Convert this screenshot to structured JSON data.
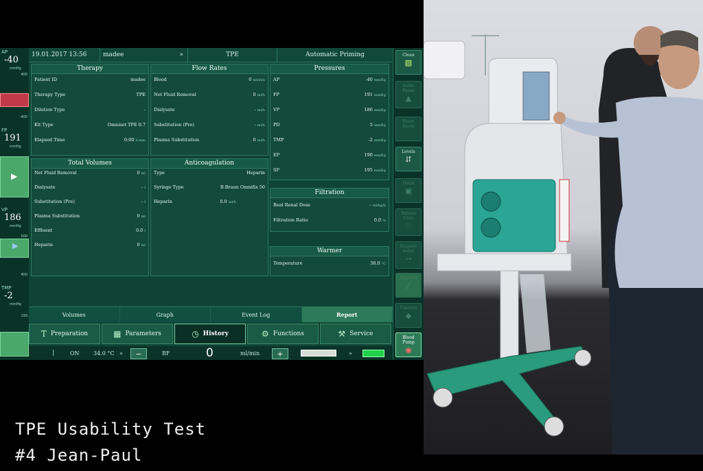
{
  "caption": {
    "line1": "TPE Usability Test",
    "line2": "#4 Jean-Paul"
  },
  "topbar": {
    "date": "19.01.2017 13:56",
    "user": "madee",
    "mode": "TPE",
    "phase": "Automatic Priming",
    "chev1": "»",
    "chev2": "»"
  },
  "left_gauges": [
    {
      "label": "AP",
      "value": "-40",
      "unit": "mmHg",
      "tick_top": "400",
      "tick_bot": "-400"
    },
    {
      "label": "FP",
      "value": "191",
      "unit": "mmHg",
      "tick_top": "",
      "tick_bot": ""
    },
    {
      "label": "VP",
      "value": "186",
      "unit": "mmHg",
      "tick_top": "500",
      "tick_bot": "400"
    },
    {
      "label": "TMP",
      "value": "-2",
      "unit": "mmHg",
      "tick_top": "150",
      "tick_bot": ""
    }
  ],
  "right_buttons": [
    {
      "label": "Clean",
      "icon": "clean-icon",
      "glyph": "▧",
      "state": "normal"
    },
    {
      "label": "Audio Pause",
      "icon": "bell-icon",
      "glyph": "▲",
      "state": "dim"
    },
    {
      "label": "Reset Alarm",
      "icon": "reset-icon",
      "glyph": "",
      "state": "dim"
    },
    {
      "label": "Levels",
      "icon": "levels-icon",
      "glyph": "⇵",
      "state": "normal"
    },
    {
      "label": "Drain",
      "icon": "drain-icon",
      "glyph": "▣",
      "state": "dim"
    },
    {
      "label": "Patient Care",
      "icon": "patient-care-icon",
      "glyph": "♡",
      "state": "dim"
    },
    {
      "label": "Heparin bolus",
      "icon": "syringe-icon",
      "glyph": "→",
      "state": "dim"
    },
    {
      "label": "Heparin",
      "icon": "heparin-icon",
      "glyph": "╱",
      "state": "dim"
    },
    {
      "label": "Unitairs",
      "icon": "unitairs-icon",
      "glyph": "◆",
      "state": "dim"
    },
    {
      "label": "Blood Pump",
      "icon": "blood-pump-icon",
      "glyph": "◉",
      "state": "active"
    }
  ],
  "panels": {
    "therapy": {
      "title": "Therapy",
      "rows": [
        {
          "k": "Patient ID",
          "v": "madee",
          "u": ""
        },
        {
          "k": "Therapy Type",
          "v": "TPE",
          "u": ""
        },
        {
          "k": "Dilution Type",
          "v": "-",
          "u": ""
        },
        {
          "k": "Kit Type",
          "v": "Omniset TPE 0.7",
          "u": ""
        },
        {
          "k": "Elapsed Time",
          "v": "0:00",
          "u": "h:mm"
        }
      ]
    },
    "flow": {
      "title": "Flow Rates",
      "rows": [
        {
          "k": "Blood",
          "v": "0",
          "u": "ml/min"
        },
        {
          "k": "Net Fluid Removal",
          "v": "0",
          "u": "ml/h"
        },
        {
          "k": "Dialysate",
          "v": "-",
          "u": "ml/h"
        },
        {
          "k": "Substitution (Pre)",
          "v": "-",
          "u": "ml/h"
        },
        {
          "k": "Plasma Substitution",
          "v": "0",
          "u": "ml/h"
        }
      ]
    },
    "pressures": {
      "title": "Pressures",
      "rows": [
        {
          "k": "AP",
          "v": "-40",
          "u": "mmHg"
        },
        {
          "k": "FP",
          "v": "191",
          "u": "mmHg"
        },
        {
          "k": "VP",
          "v": "186",
          "u": "mmHg"
        },
        {
          "k": "PD",
          "v": "5",
          "u": "mmHg"
        },
        {
          "k": "TMP",
          "v": "-2",
          "u": "mmHg"
        },
        {
          "k": "EP",
          "v": "190",
          "u": "mmHg"
        },
        {
          "k": "SP",
          "v": "195",
          "u": "mmHg"
        }
      ]
    },
    "volumes": {
      "title": "Total Volumes",
      "rows": [
        {
          "k": "Net Fluid Removal",
          "v": "0",
          "u": "ml"
        },
        {
          "k": "Dialysate",
          "v": "-",
          "u": "l"
        },
        {
          "k": "Substitution (Pre)",
          "v": "-",
          "u": "l"
        },
        {
          "k": "Plasma Substitution",
          "v": "0",
          "u": "ml"
        },
        {
          "k": "Effluent",
          "v": "0.0",
          "u": "l"
        },
        {
          "k": "Heparin",
          "v": "0",
          "u": "ml"
        }
      ]
    },
    "anticoag": {
      "title": "Anticoagulation",
      "rows": [
        {
          "k": "Type",
          "v": "Heparin",
          "u": ""
        },
        {
          "k": "Syringe Type",
          "v": "B.Braun Omnifix 50",
          "u": ""
        },
        {
          "k": "Heparin",
          "v": "0.0",
          "u": "ml/h"
        }
      ]
    },
    "filtration": {
      "title": "Filtration",
      "rows": [
        {
          "k": "Real Renal Dose",
          "v": "-",
          "u": "ml/kg/h"
        },
        {
          "k": "Filtration Ratio",
          "v": "0.0",
          "u": "%"
        }
      ]
    },
    "warmer": {
      "title": "Warmer",
      "rows": [
        {
          "k": "Temperature",
          "v": "38.0",
          "u": "°C"
        }
      ]
    }
  },
  "subtabs": [
    {
      "label": "Volumes",
      "active": false
    },
    {
      "label": "Graph",
      "active": false
    },
    {
      "label": "Event Log",
      "active": false
    },
    {
      "label": "Report",
      "active": true
    }
  ],
  "maintabs": [
    {
      "label": "Preparation",
      "icon": "preparation-icon",
      "glyph": "T",
      "active": false
    },
    {
      "label": "Parameters",
      "icon": "calculator-icon",
      "glyph": "▦",
      "active": false
    },
    {
      "label": "History",
      "icon": "clock-icon",
      "glyph": "◷",
      "active": true
    },
    {
      "label": "Functions",
      "icon": "gear-icon",
      "glyph": "⚙",
      "active": false
    },
    {
      "label": "Service",
      "icon": "wrench-icon",
      "glyph": "⚒",
      "active": false
    }
  ],
  "bottombar": {
    "heater_state": "ON",
    "temp": "34.0 °C",
    "minus": "−",
    "plus": "+",
    "pump_label": "BF",
    "pump_value": "0",
    "pump_unit": "ml/min",
    "chev": "»"
  }
}
